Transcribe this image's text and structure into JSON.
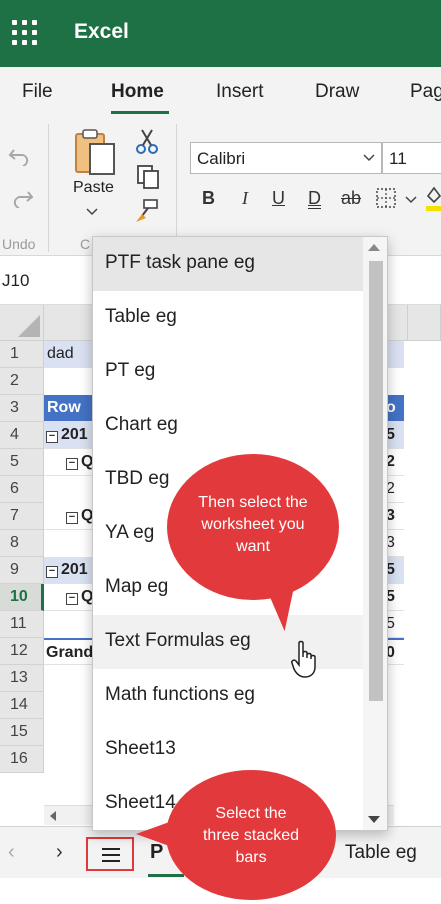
{
  "app": {
    "title": "Excel"
  },
  "ribbon_tabs": [
    "File",
    "Home",
    "Insert",
    "Draw",
    "Pag"
  ],
  "ribbon": {
    "undo_label": "Undo",
    "paste_label": "Paste",
    "clipboard_label": "C",
    "font_name": "Calibri",
    "font_size": "11",
    "bold": "B",
    "italic": "I",
    "underline": "U",
    "double_underline": "D",
    "strikethrough": "ab"
  },
  "namebox": "J10",
  "grid": {
    "row_numbers": [
      "1",
      "2",
      "3",
      "4",
      "5",
      "6",
      "7",
      "8",
      "9",
      "10",
      "11",
      "12",
      "13",
      "14",
      "15",
      "16"
    ],
    "selected_row": "10",
    "left_cells": {
      "r1": "dad",
      "r3": "Row",
      "r4": "201",
      "r5": "Q",
      "r7": "Q",
      "r9": "201",
      "r10": "Q",
      "r12": "Grand"
    },
    "right_values": {
      "r3": "o",
      "r4": "5",
      "r5": "2",
      "r6": "2",
      "r7": "3",
      "r8": "3",
      "r9": "5",
      "r10": "5",
      "r11": "5",
      "r12": "0"
    }
  },
  "sheet_list": {
    "items": [
      "PTF task pane eg",
      "Table eg",
      "PT eg",
      "Chart eg",
      "TBD eg",
      "YA eg",
      "Map eg",
      "Text Formulas eg",
      "Math functions eg",
      "Sheet13",
      "Sheet14"
    ],
    "selected": "PTF task pane eg",
    "hovered": "Text Formulas eg"
  },
  "sheet_bar": {
    "prev": "‹",
    "next": "›",
    "active_tab_partial": "P",
    "next_tab": "Table eg"
  },
  "callouts": {
    "top": "Then select the worksheet you want",
    "bottom": "Select the three stacked bars"
  },
  "colors": {
    "brand": "#1e7145",
    "callout": "#e23a3c",
    "pivot_header": "#4472c4",
    "pivot_light": "#d9e1f2"
  }
}
